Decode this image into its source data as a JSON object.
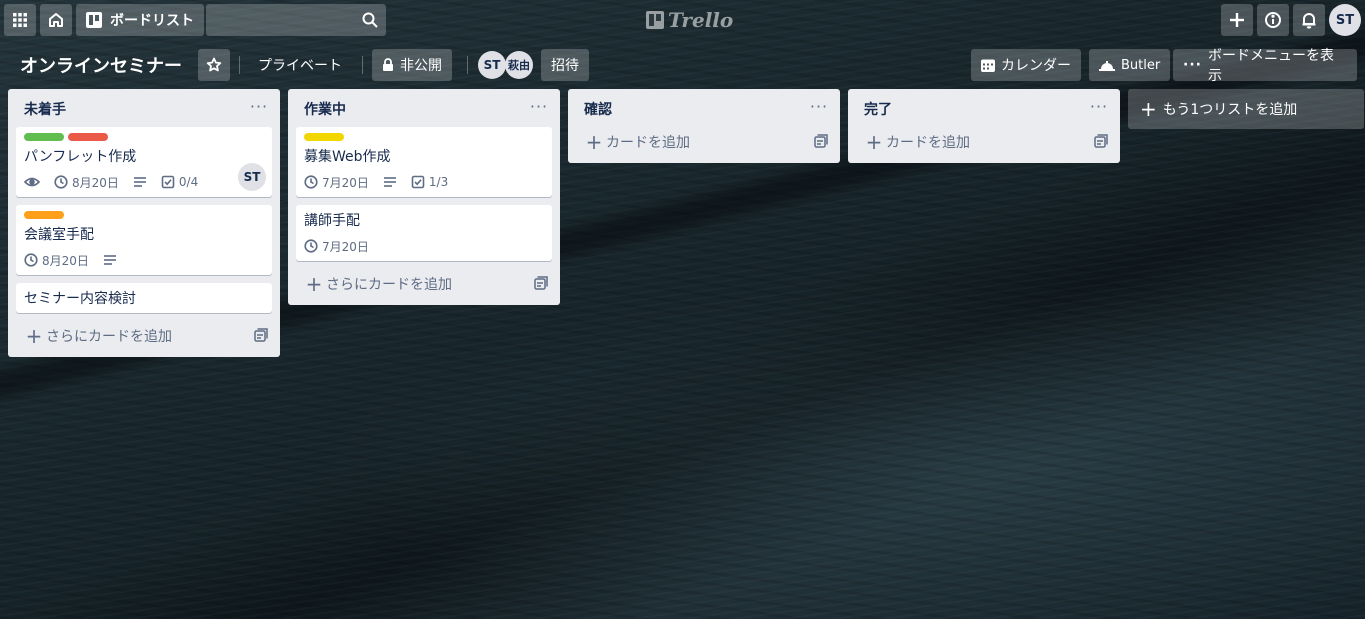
{
  "header": {
    "boards_label": "ボードリスト",
    "search_placeholder": "",
    "logo_text": "Trello",
    "member_initials": "ST"
  },
  "board": {
    "title": "オンラインセミナー",
    "visibility_team": "プライベート",
    "visibility_private": "非公開",
    "members": [
      "ST",
      "萩由"
    ],
    "invite_label": "招待",
    "calendar_label": "カレンダー",
    "butler_label": "Butler",
    "menu_label": "ボードメニューを表示"
  },
  "lists": [
    {
      "title": "未着手",
      "cards": [
        {
          "labels": [
            "#61bd4f",
            "#eb5a46"
          ],
          "title": "パンフレット作成",
          "watch": true,
          "due": "8月20日",
          "description": true,
          "checklist": "0/4",
          "member": "ST"
        },
        {
          "labels": [
            "#ff9f1a"
          ],
          "title": "会議室手配",
          "due": "8月20日",
          "description": true
        },
        {
          "labels": [],
          "title": "セミナー内容検討"
        }
      ],
      "add_label": "さらにカードを追加"
    },
    {
      "title": "作業中",
      "cards": [
        {
          "labels": [
            "#f2d600"
          ],
          "title": "募集Web作成",
          "due": "7月20日",
          "description": true,
          "checklist": "1/3"
        },
        {
          "labels": [],
          "title": "講師手配",
          "due": "7月20日"
        }
      ],
      "add_label": "さらにカードを追加"
    },
    {
      "title": "確認",
      "cards": [],
      "add_label": "カードを追加"
    },
    {
      "title": "完了",
      "cards": [],
      "add_label": "カードを追加"
    }
  ],
  "add_list_label": "もう1つリストを追加",
  "colors": {
    "label_green": "#61bd4f",
    "label_red": "#eb5a46",
    "label_orange": "#ff9f1a",
    "label_yellow": "#f2d600",
    "list_bg": "#ebecf0"
  },
  "icons": [
    "apps-grid-icon",
    "home-icon",
    "boards-icon",
    "search-icon",
    "plus-icon",
    "info-icon",
    "bell-icon",
    "star-icon",
    "lock-icon",
    "calendar-icon",
    "butler-icon",
    "ellipsis-icon",
    "eye-icon",
    "clock-icon",
    "description-icon",
    "checklist-icon",
    "template-icon"
  ]
}
